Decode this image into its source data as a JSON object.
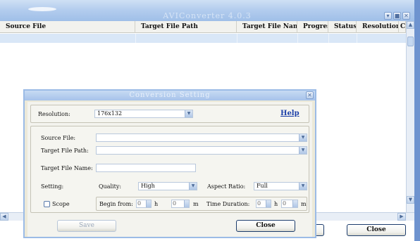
{
  "main": {
    "title": "AVIConverter 4.0.3",
    "title_buttons": [
      "▾",
      "■",
      "✕"
    ],
    "columns": [
      "Source File",
      "Target File Path",
      "Target File Name",
      "Progress",
      "Status",
      "Resolution",
      "C"
    ],
    "close_button": "Close"
  },
  "dialog": {
    "title": "Conversion Setting",
    "close_glyph": "✕",
    "resolution_label": "Resolution:",
    "resolution_value": "176x132",
    "help_link": "Help",
    "source_file_label": "Source File:",
    "source_file_value": "",
    "target_path_label": "Target File Path:",
    "target_path_value": "",
    "target_name_label": "Target File Name:",
    "target_name_value": "",
    "setting_label": "Setting:",
    "quality_label": "Quality:",
    "quality_value": "High",
    "aspect_label": "Aspect Ratio:",
    "aspect_value": "Full",
    "scope_label": "Scope",
    "begin_label": "Begin from:",
    "begin_h_value": "0",
    "h_unit": "h",
    "begin_m_value": "0",
    "m_unit": "m",
    "duration_label": "Time Duration:",
    "dur_h_value": "0",
    "dur_m_value": "0",
    "save_button": "Save",
    "close_button": "Close"
  },
  "colors": {
    "title_bar": "#a6c2ea",
    "dialog_bg": "#ece9d8",
    "help_link": "#1b3fa8",
    "grid_row": "#d9e7f7"
  },
  "icons": {
    "dropdown": "chevron-down-icon",
    "scroll_up": "arrow-up-icon",
    "scroll_down": "arrow-down-icon",
    "scroll_left": "arrow-left-icon",
    "scroll_right": "arrow-right-icon"
  }
}
